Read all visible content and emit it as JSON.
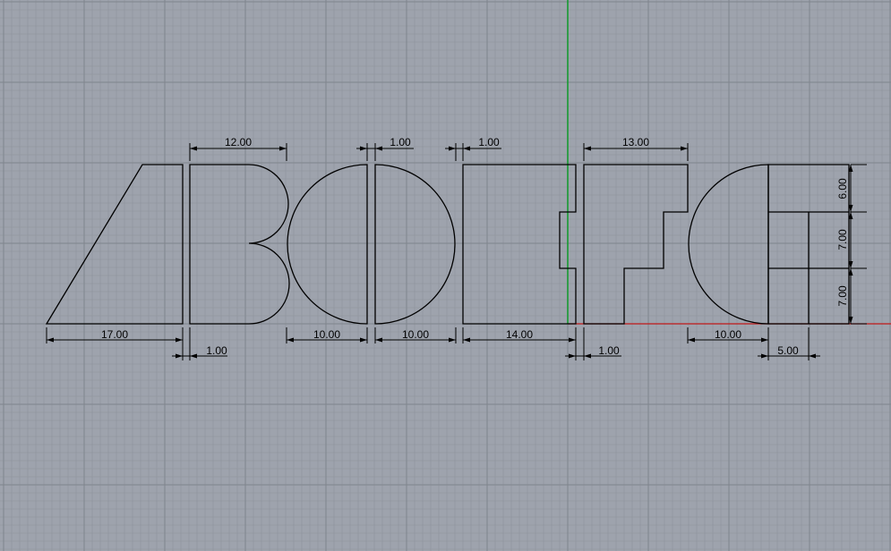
{
  "viewport": {
    "background": "#9ea3ad",
    "grid_minor_color": "#8e939c",
    "grid_major_color": "#7f848d",
    "x_axis_color": "#c01818",
    "y_axis_color": "#0f9a2a",
    "geometry_color": "#000000"
  },
  "letters": [
    "A",
    "B",
    "C",
    "D",
    "E",
    "F",
    "G",
    "H"
  ],
  "dimensions": {
    "a_width": "17.00",
    "a_b_gap": "1.00",
    "b_top_width": "12.00",
    "b_bottom_radius": "10.00",
    "d_top_gap": "1.00",
    "d_bottom_radius": "10.00",
    "e_top_gap": "1.00",
    "e_bottom_width": "14.00",
    "f_left_gap": "1.00",
    "f_top_width": "13.00",
    "g_bottom_radius": "10.00",
    "h_bottom_width": "5.00",
    "h_top_height": "6.00",
    "h_mid_height": "7.00",
    "h_bottom_height": "7.00"
  }
}
